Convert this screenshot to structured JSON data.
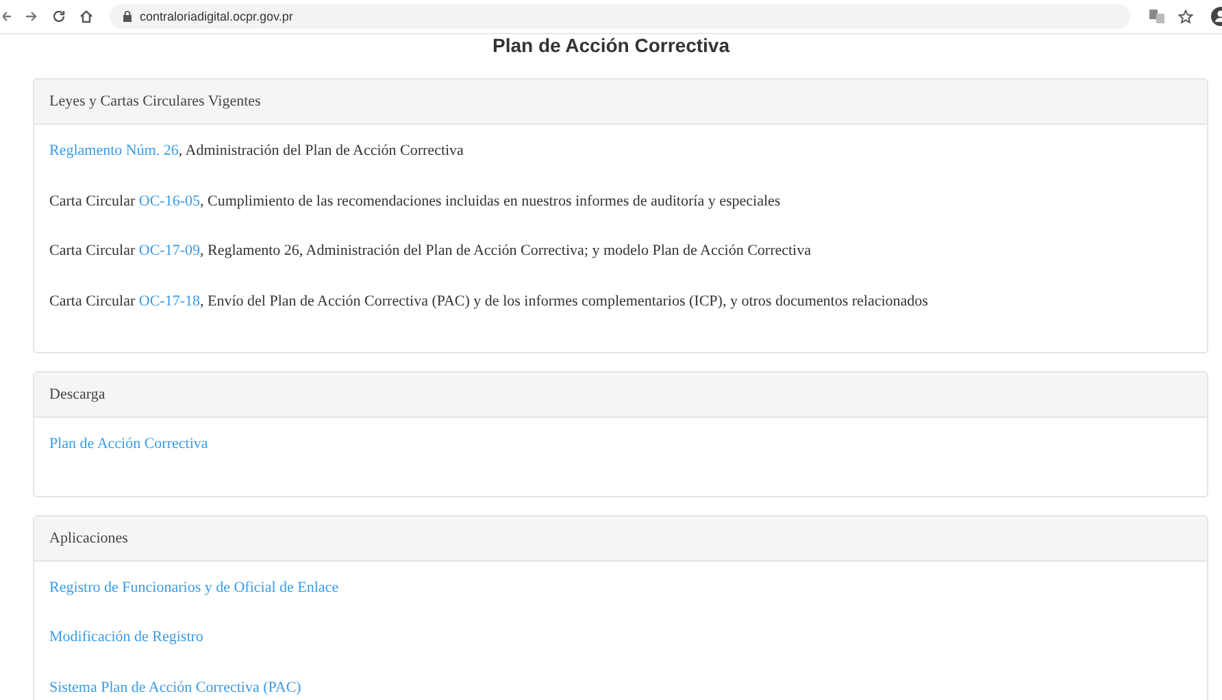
{
  "browser": {
    "url": "contraloriadigital.ocpr.gov.pr"
  },
  "page_title": "Plan de Acción Correctiva",
  "sections": [
    {
      "title": "Leyes y Cartas Circulares Vigentes",
      "items": [
        {
          "link": "Reglamento Núm. 26",
          "suffix": ", Administración del Plan de Acción Correctiva"
        },
        {
          "prefix": "Carta Circular ",
          "link": "OC-16-05",
          "suffix": ", Cumplimiento de las recomendaciones incluidas en nuestros informes de auditoría  y especiales"
        },
        {
          "prefix": "Carta Circular ",
          "link": "OC-17-09",
          "suffix": ", Reglamento 26, Administración del Plan de Acción Correctiva; y modelo Plan de Acción Correctiva"
        },
        {
          "prefix": "Carta Circular ",
          "link": "OC-17-18",
          "suffix": ", Envío del Plan de Acción Correctiva (PAC) y de los informes complementarios (ICP), y otros documentos relacionados"
        }
      ]
    },
    {
      "title": "Descarga",
      "items": [
        {
          "link": "Plan de Acción Correctiva"
        }
      ]
    },
    {
      "title": "Aplicaciones",
      "items": [
        {
          "link": "Registro de Funcionarios y de Oficial de Enlace"
        },
        {
          "link": "Modificación de Registro"
        },
        {
          "link": "Sistema Plan de Acción Correctiva (PAC)"
        }
      ]
    }
  ]
}
